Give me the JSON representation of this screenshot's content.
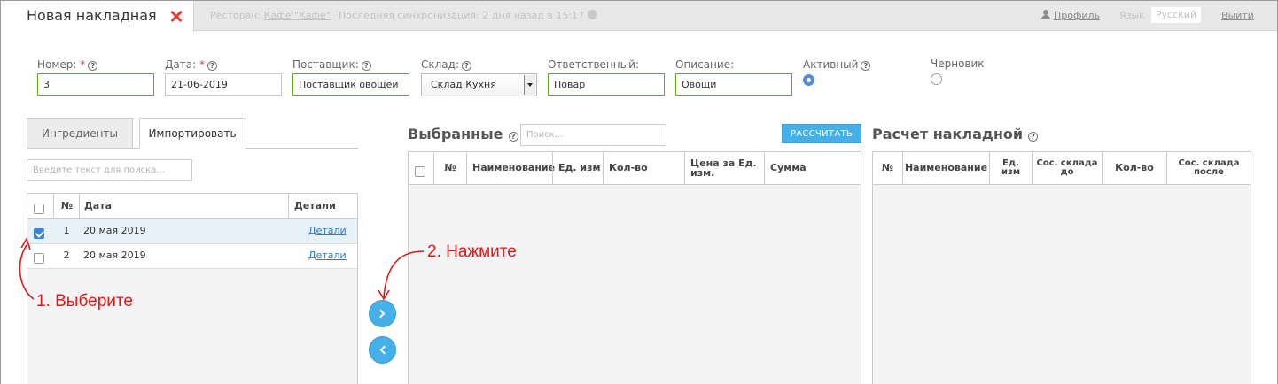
{
  "header": {
    "title": "Новая накладная",
    "restaurant_label": "Ресторан:",
    "restaurant_value": "Кафе \"Кафе\"",
    "sync_text": "Последняя синхронизация: 2 дня назад в 15:17",
    "profile_link": "Профиль",
    "language_label": "Язык",
    "language_value": "Русский",
    "logout_link": "Выйти"
  },
  "form": {
    "number": {
      "label": "Номер:",
      "required": "*",
      "value": "3"
    },
    "date": {
      "label": "Дата:",
      "required": "*",
      "value": "21-06-2019"
    },
    "supplier": {
      "label": "Поставщик:",
      "value": "Поставщик овощей"
    },
    "warehouse": {
      "label": "Склад:",
      "value": "Склад Кухня"
    },
    "responsible": {
      "label": "Ответственный:",
      "value": "Повар"
    },
    "description": {
      "label": "Описание:",
      "value": "Овощи"
    },
    "active": {
      "label": "Активный",
      "checked": true
    },
    "draft": {
      "label": "Черновик",
      "checked": false
    },
    "help_glyph": "?"
  },
  "left_panel": {
    "tabs": [
      {
        "label": "Ингредиенты",
        "active": false
      },
      {
        "label": "Импортировать",
        "active": true
      }
    ],
    "search_placeholder": "Введите текст для поиска...",
    "columns": {
      "num": "№",
      "date": "Дата",
      "details": "Детали"
    },
    "rows": [
      {
        "num": "1",
        "date": "20 мая 2019",
        "details": "Детали",
        "checked": true
      },
      {
        "num": "2",
        "date": "20 мая 2019",
        "details": "Детали",
        "checked": false
      }
    ]
  },
  "selected_panel": {
    "title": "Выбранные",
    "search_placeholder": "Поиск...",
    "calc_button": "РАССЧИТАТЬ",
    "columns": {
      "num": "№",
      "name": "Наименование",
      "unit": "Ед. изм",
      "qty": "Кол-во",
      "price_line1": "Цена за Ед.",
      "price_line2": "изм.",
      "sum": "Сумма"
    }
  },
  "calc_panel": {
    "title": "Расчет накладной",
    "columns": {
      "num": "№",
      "name": "Наименование",
      "unit_line1": "Ед.",
      "unit_line2": "изм",
      "before_line1": "Сос. склада",
      "before_line2": "до",
      "qty": "Кол-во",
      "after_line1": "Сос. склада",
      "after_line2": "после"
    }
  },
  "annotations": {
    "step1": "1. Выберите",
    "step2": "2. Нажмите",
    "color": "#e01818"
  },
  "colors": {
    "accent": "#45b0e8",
    "valid_border": "#62a62d",
    "close": "#e0403a",
    "radio_on": "#4d8ee2"
  }
}
